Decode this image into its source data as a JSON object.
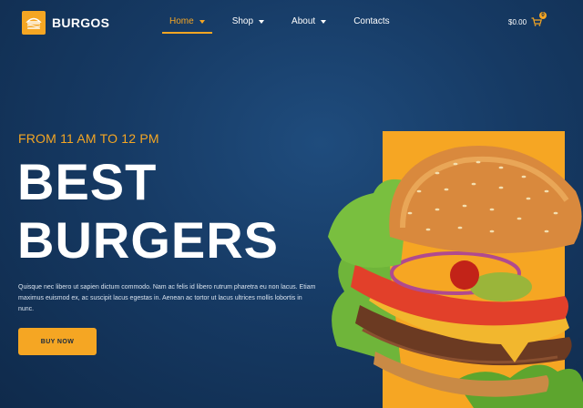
{
  "brand": {
    "name": "BURGOS",
    "accent": "#f5a623"
  },
  "nav": [
    {
      "label": "Home",
      "has_caret": true,
      "active": true
    },
    {
      "label": "Shop",
      "has_caret": true,
      "active": false
    },
    {
      "label": "About",
      "has_caret": true,
      "active": false
    },
    {
      "label": "Contacts",
      "has_caret": false,
      "active": false
    }
  ],
  "cart": {
    "total": "$0.00",
    "count": "0",
    "icon": "cart-icon"
  },
  "hero": {
    "hours": "FROM 11 AM TO 12 PM",
    "headline_line1": "BEST",
    "headline_line2": "BURGERS",
    "description": "Quisque nec libero ut sapien dictum commodo. Nam ac felis id libero rutrum pharetra eu non lacus. Etiam maximus euismod ex, ac suscipit lacus egestas in. Aenean ac tortor ut lacus ultrices mollis lobortis in nunc.",
    "cta_label": "BUY NOW"
  },
  "image": {
    "subject": "burger-photo"
  }
}
